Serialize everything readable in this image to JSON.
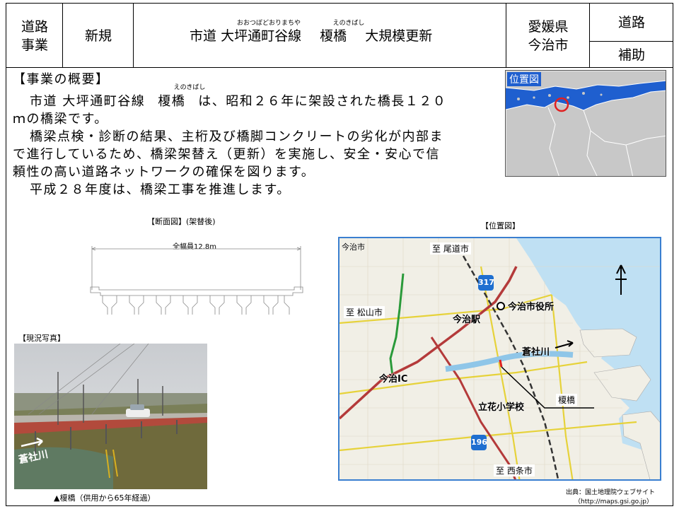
{
  "header": {
    "category_line1": "道路",
    "category_line2": "事業",
    "status": "新規",
    "title_prefix": "市道",
    "route_name": "大坪通町谷線",
    "route_ruby": "おおつぼどおりまちや",
    "bridge_name": "榎橋",
    "bridge_ruby": "えのきばし",
    "title_suffix": "大規模更新",
    "prefecture": "愛媛県",
    "city": "今治市",
    "type_top": "道路",
    "type_bottom": "補助"
  },
  "overview": {
    "heading": "【事業の概要】",
    "line1_a": "市道 大坪通町谷線",
    "line1_bridge": "榎橋",
    "line1_ruby": "えのきばし",
    "line1_b": "は、昭和２６年に架設された橋長１２０",
    "line2": "ｍの橋梁です。",
    "line3": "橋梁点検・診断の結果、主桁及び橋脚コンクリートの劣化が内部ま",
    "line4": "で進行しているため、橋梁架替え（更新）を実施し、安全・安心で信",
    "line5": "頼性の高い道路ネットワークの確保を図ります。",
    "line6": "平成２８年度は、橋梁工事を推進します。"
  },
  "inset_map": {
    "label": "位置図"
  },
  "section": {
    "title": "【断面図】(架替後)",
    "width_label": "全幅員12.8m"
  },
  "photo": {
    "title": "【現況写真】",
    "river_label": "蒼社川",
    "caption": "▲榎橋（供用から65年経過）"
  },
  "map": {
    "title": "【位置図】",
    "labels": {
      "city_left": "今治市",
      "to_onomichi": "至 尾道市",
      "to_matsuyama": "至 松山市",
      "station": "今治駅",
      "city_hall": "今治市役所",
      "river": "蒼社川",
      "ic": "今治IC",
      "school": "立花小学校",
      "bridge": "榎橋",
      "to_saijo": "至 西条市",
      "route_317": "317",
      "route_196": "196"
    },
    "source_line1": "出典：国土地理院ウェブサイト",
    "source_line2": "（http://maps.gsi.go.jp）"
  },
  "colors": {
    "inset_sea": "#1f5fcf",
    "route_sign": "#1f6fd0",
    "railway": "#333333",
    "main_road": "#b43a3a",
    "green_road": "#2a9a3a",
    "river_red": "#e02020"
  }
}
